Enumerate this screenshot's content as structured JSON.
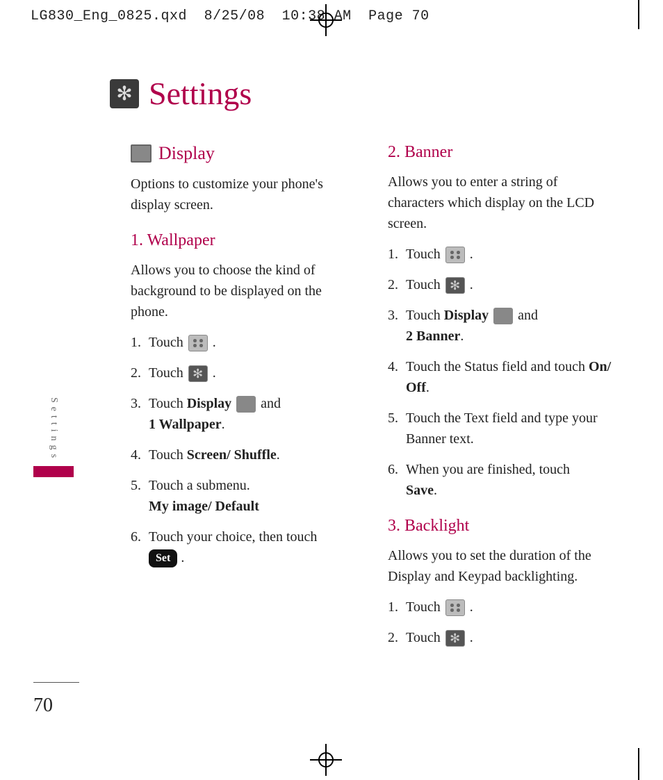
{
  "header": {
    "file": "LG830_Eng_0825.qxd",
    "date": "8/25/08",
    "time": "10:38 AM",
    "page_label": "Page 70"
  },
  "title": "Settings",
  "side_tab": "Settings",
  "page_number": "70",
  "col1": {
    "display_heading": "Display",
    "display_intro": "Options to customize your phone's display screen.",
    "wallpaper_heading": "1. Wallpaper",
    "wallpaper_intro": "Allows you to choose the kind of background to be displayed on the phone.",
    "steps": {
      "s1_a": "Touch ",
      "s1_b": ".",
      "s2_a": "Touch ",
      "s2_b": ".",
      "s3_a": "Touch ",
      "s3_bold1": "Display",
      "s3_mid": " ",
      "s3_b": " and",
      "s3_bold2": "1 Wallpaper",
      "s3_end": ".",
      "s4_a": "Touch ",
      "s4_bold": "Screen/ Shuffle",
      "s4_b": ".",
      "s5_a": "Touch a submenu.",
      "s5_bold": "My image/ Default",
      "s6_a": "Touch your choice, then touch",
      "s6_btn": "Set",
      "s6_b": "."
    }
  },
  "col2": {
    "banner_heading": "2. Banner",
    "banner_intro": "Allows you to enter a string of characters which display on the LCD screen.",
    "banner_steps": {
      "s1_a": "Touch ",
      "s1_b": ".",
      "s2_a": "Touch ",
      "s2_b": ".",
      "s3_a": "Touch ",
      "s3_bold1": "Display",
      "s3_b": " and",
      "s3_bold2": "2 Banner",
      "s3_end": ".",
      "s4_a": "Touch the Status field and touch ",
      "s4_bold": "On/ Off",
      "s4_b": ".",
      "s5_a": "Touch the Text field and type your Banner text.",
      "s6_a": "When you are finished, touch",
      "s6_bold": "Save",
      "s6_b": "."
    },
    "backlight_heading": "3. Backlight",
    "backlight_intro": "Allows you to set the duration of the Display and Keypad backlighting.",
    "backlight_steps": {
      "s1_a": "Touch ",
      "s1_b": ".",
      "s2_a": "Touch ",
      "s2_b": "."
    }
  }
}
